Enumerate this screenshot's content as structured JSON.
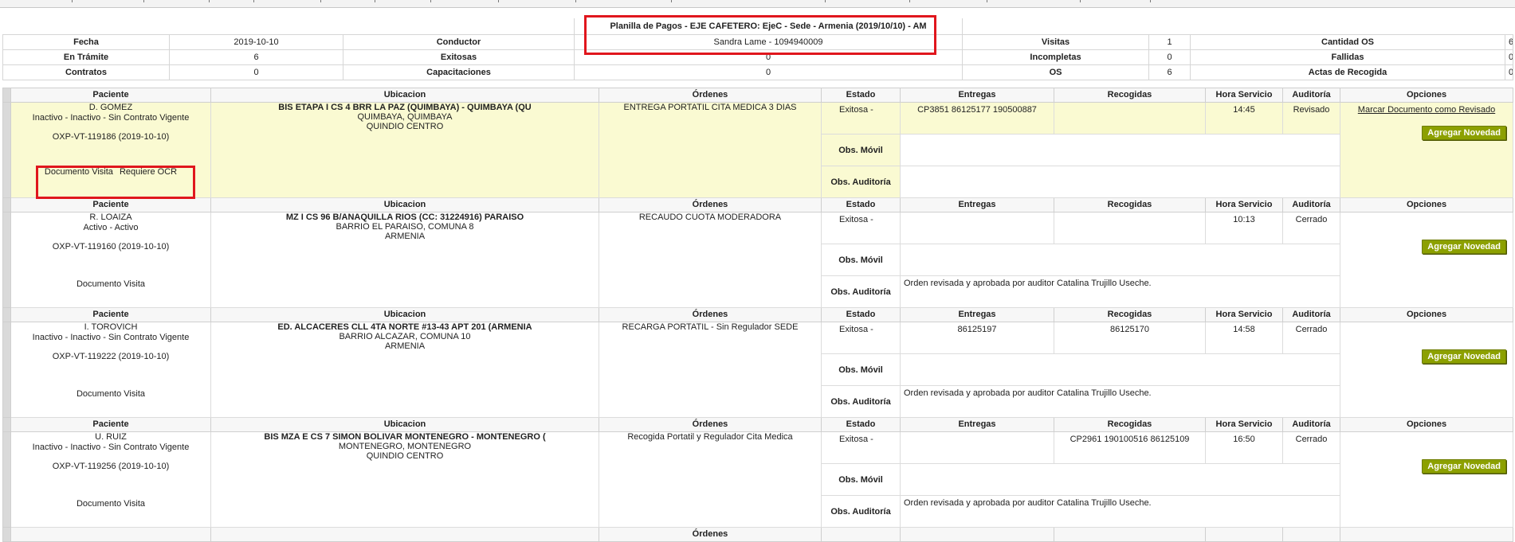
{
  "summary": {
    "title": "Planilla de Pagos - EJE CAFETERO: EjeC - Sede - Armenia (2019/10/10) - AM",
    "row1": {
      "fecha_label": "Fecha",
      "fecha": "2019-10-10",
      "conductor_label": "Conductor",
      "conductor": "Sandra Lame - 1094940009",
      "visitas_label": "Visitas",
      "visitas": "1",
      "cantidad_os_label": "Cantidad OS",
      "cantidad_os": "6"
    },
    "row2": {
      "en_tramite_label": "En Trámite",
      "en_tramite": "6",
      "exitosas_label": "Exitosas",
      "exitosas": "0",
      "incompletas_label": "Incompletas",
      "incompletas": "0",
      "fallidas_label": "Fallidas",
      "fallidas": "0"
    },
    "row3": {
      "contratos_label": "Contratos",
      "contratos": "0",
      "capacitaciones_label": "Capacitaciones",
      "capacitaciones": "0",
      "os_label": "OS",
      "os": "6",
      "actas_label": "Actas de Recogida",
      "actas": "0"
    }
  },
  "headers": {
    "paciente": "Paciente",
    "ubicacion": "Ubicacion",
    "ordenes": "Órdenes",
    "estado": "Estado",
    "entregas": "Entregas",
    "recogidas": "Recogidas",
    "hora": "Hora Servicio",
    "auditoria": "Auditoría",
    "opciones": "Opciones"
  },
  "labels": {
    "obs_movil": "Obs. Móvil",
    "obs_auditoria": "Obs. Auditoría",
    "documento_visita": "Documento Visita",
    "requiere_ocr": "Requiere OCR",
    "agregar_novedad": "Agregar Novedad",
    "marcar_revisado": "Marcar Documento como Revisado"
  },
  "records": [
    {
      "nombre": "D. GOMEZ",
      "estado_paciente": "Inactivo - Inactivo - Sin Contrato Vigente",
      "orden": "OXP-VT-119186 (2019-10-10)",
      "dir1": "BIS ETAPA I CS 4 BRR LA PAZ (QUIMBAYA) - QUIMBAYA (QU",
      "dir2": "QUIMBAYA, QUIMBAYA",
      "dir3": "QUINDIO CENTRO",
      "ordenes": "ENTREGA PORTATIL CITA MEDICA 3 DIAS",
      "estado": "Exitosa -",
      "entregas": "CP3851 86125177 190500887",
      "recogidas": "",
      "hora": "14:45",
      "auditoria": "Revisado",
      "obs_movil": "",
      "obs_auditoria": ""
    },
    {
      "nombre": "R. LOAIZA",
      "estado_paciente": "Activo - Activo",
      "orden": "OXP-VT-119160 (2019-10-10)",
      "dir1": "MZ I CS 96 B/ANAQUILLA RIOS (CC: 31224916) PARAISO",
      "dir2": "BARRIO EL PARAISO, COMUNA 8",
      "dir3": "ARMENIA",
      "ordenes": "RECAUDO CUOTA MODERADORA",
      "estado": "Exitosa -",
      "entregas": "",
      "recogidas": "",
      "hora": "10:13",
      "auditoria": "Cerrado",
      "obs_movil": "",
      "obs_auditoria": "Orden revisada y aprobada por auditor Catalina Trujillo Useche."
    },
    {
      "nombre": "I. TOROVICH",
      "estado_paciente": "Inactivo - Inactivo - Sin Contrato Vigente",
      "orden": "OXP-VT-119222 (2019-10-10)",
      "dir1": "ED. ALCACERES CLL 4TA NORTE #13-43 APT 201 (ARMENIA",
      "dir2": "BARRIO ALCAZAR, COMUNA 10",
      "dir3": "ARMENIA",
      "ordenes": "RECARGA PORTATIL - Sin Regulador SEDE",
      "estado": "Exitosa -",
      "entregas": "86125197",
      "recogidas": "86125170",
      "hora": "14:58",
      "auditoria": "Cerrado",
      "obs_movil": "",
      "obs_auditoria": "Orden revisada y aprobada por auditor Catalina Trujillo Useche."
    },
    {
      "nombre": "U. RUIZ",
      "estado_paciente": "Inactivo - Inactivo - Sin Contrato Vigente",
      "orden": "OXP-VT-119256 (2019-10-10)",
      "dir1": "BIS MZA E CS 7 SIMON BOLIVAR MONTENEGRO - MONTENEGRO (",
      "dir2": "MONTENEGRO, MONTENEGRO",
      "dir3": "QUINDIO CENTRO",
      "ordenes": "Recogida Portatil y Regulador Cita Medica",
      "estado": "Exitosa -",
      "entregas": "",
      "recogidas": "CP2961 190100516 86125109",
      "hora": "16:50",
      "auditoria": "Cerrado",
      "obs_movil": "",
      "obs_auditoria": "Orden revisada y aprobada por auditor Catalina Trujillo Useche."
    }
  ],
  "partial_row": {
    "ordenes": "Órdenes"
  },
  "colors": {
    "highlight_row": "#fafad2",
    "button": "#8ca000",
    "annotation": "#e0161d"
  }
}
